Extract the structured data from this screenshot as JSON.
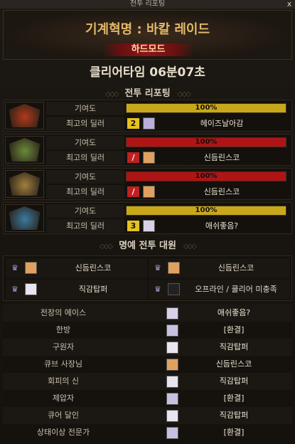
{
  "window": {
    "title": "전투 리포팅",
    "close_label": "x"
  },
  "header": {
    "raid_title": "기계혁명 : 바칼 레이드",
    "mode_label": "하드모드"
  },
  "clear_time": "클리어타임 06분07초",
  "report_section": {
    "title": "전투 리포팅"
  },
  "reports": [
    {
      "contribution_label": "기여도",
      "contribution_value": "100%",
      "contribution_fraction": 1.0,
      "bar_color": "#c8a81a",
      "top_dealer_label": "최고의 딜러",
      "badge": "2",
      "badge_color": "#e6c21f",
      "avatar_color": "#b8b0d8",
      "dealer": "헤이즈날아감",
      "boss_color": "#b03a1c"
    },
    {
      "contribution_label": "기여도",
      "contribution_value": "100%",
      "contribution_fraction": 1.0,
      "bar_color": "#b01414",
      "top_dealer_label": "최고의 딜러",
      "badge": "/",
      "badge_color": "#c02020",
      "avatar_color": "#e0a060",
      "dealer": "신듬린스코",
      "boss_color": "#6a8a3a"
    },
    {
      "contribution_label": "기여도",
      "contribution_value": "100%",
      "contribution_fraction": 1.0,
      "bar_color": "#b01414",
      "top_dealer_label": "최고의 딜러",
      "badge": "/",
      "badge_color": "#c02020",
      "avatar_color": "#e0a060",
      "dealer": "신듬린스코",
      "boss_color": "#a08040"
    },
    {
      "contribution_label": "기여도",
      "contribution_value": "100%",
      "contribution_fraction": 1.0,
      "bar_color": "#c8a81a",
      "top_dealer_label": "최고의 딜러",
      "badge": "3",
      "badge_color": "#e6c21f",
      "avatar_color": "#d8d0e8",
      "dealer": "애쉬좋음?",
      "boss_color": "#3a7aa0"
    }
  ],
  "honor_section": {
    "title": "명예 전투 대원"
  },
  "honor": [
    {
      "name": "신듬린스코",
      "avatar_color": "#e0a060"
    },
    {
      "name": "신듬린스코",
      "avatar_color": "#e0a060"
    },
    {
      "name": "직감탑퍼",
      "avatar_color": "#e8e4f0"
    },
    {
      "name": "오프라인 / 쿨리어 미충족",
      "avatar_color": "#222222"
    }
  ],
  "awards": [
    {
      "label": "전장의 에이스",
      "winner": "애쉬좋음?",
      "avatar_color": "#d8d0e8"
    },
    {
      "label": "한방",
      "winner": "[환결]",
      "avatar_color": "#c8c0e0"
    },
    {
      "label": "구원자",
      "winner": "직감탑퍼",
      "avatar_color": "#e8e4f0"
    },
    {
      "label": "큐브 사장님",
      "winner": "신듬린스코",
      "avatar_color": "#e0a060"
    },
    {
      "label": "회피의 신",
      "winner": "직감탑퍼",
      "avatar_color": "#e8e4f0"
    },
    {
      "label": "제압자",
      "winner": "[환결]",
      "avatar_color": "#c8c0e0"
    },
    {
      "label": "큐어 달인",
      "winner": "직감탑퍼",
      "avatar_color": "#e8e4f0"
    },
    {
      "label": "상태이상 전문가",
      "winner": "[환결]",
      "avatar_color": "#c8c0e0"
    }
  ]
}
